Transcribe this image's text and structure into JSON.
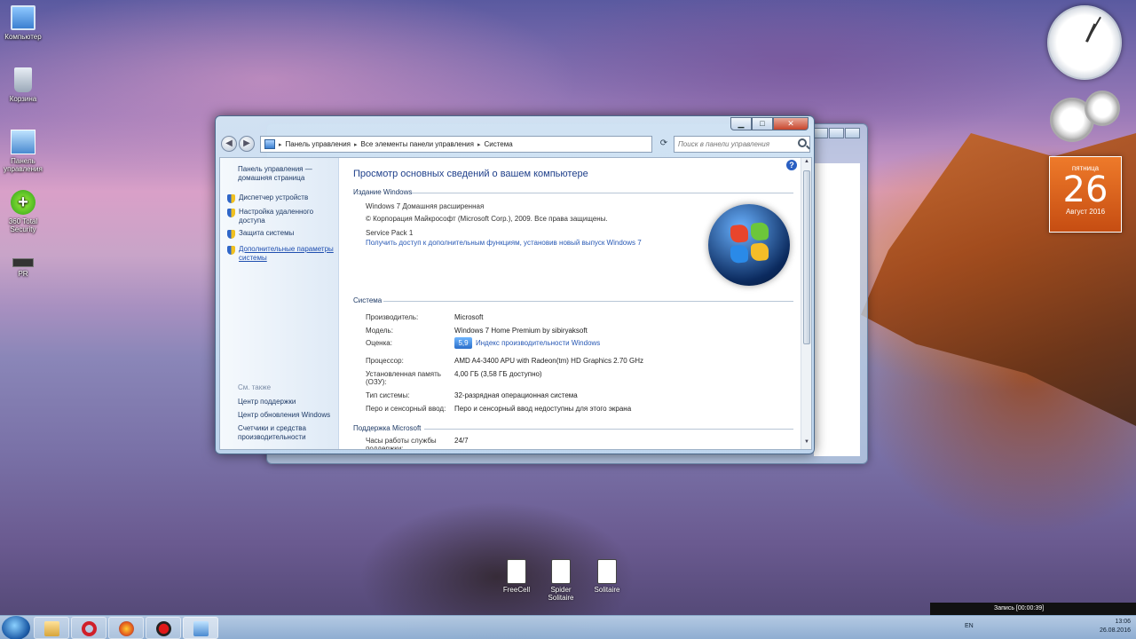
{
  "desktop": {
    "icons": [
      {
        "label": "Компьютер"
      },
      {
        "label": "Корзина"
      },
      {
        "label": "Панель управления"
      },
      {
        "label": "360 Total Security"
      },
      {
        "label": "PR"
      }
    ],
    "games": [
      {
        "label": "FreeCell"
      },
      {
        "label": "Spider Solitaire"
      },
      {
        "label": "Solitaire"
      }
    ]
  },
  "window": {
    "controls": {
      "minimize": "▁",
      "maximize": "□",
      "close": "✕"
    },
    "nav": {
      "back": "◀",
      "forward": "▶"
    },
    "breadcrumb": [
      "Панель управления",
      "Все элементы панели управления",
      "Система"
    ],
    "search_placeholder": "Поиск в панели управления",
    "sidebar": {
      "home": "Панель управления — домашняя страница",
      "items": [
        "Диспетчер устройств",
        "Настройка удаленного доступа",
        "Защита системы",
        "Дополнительные параметры системы"
      ],
      "see_also_label": "См. также",
      "see_also": [
        "Центр поддержки",
        "Центр обновления Windows",
        "Счетчики и средства производительности"
      ]
    },
    "main": {
      "title": "Просмотр основных сведений о вашем компьютере",
      "edition_header": "Издание Windows",
      "edition": "Windows 7 Домашняя расширенная",
      "copyright": "© Корпорация Майкрософт (Microsoft Corp.), 2009. Все права защищены.",
      "service_pack": "Service Pack 1",
      "upgrade_link": "Получить доступ к дополнительным функциям, установив новый выпуск Windows 7",
      "system_header": "Система",
      "rows": [
        {
          "label": "Производитель:",
          "value": "Microsoft"
        },
        {
          "label": "Модель:",
          "value": "Windows 7 Home Premium by sibiryaksoft"
        },
        {
          "label": "Оценка:",
          "value": "Индекс производительности Windows"
        },
        {
          "label": "Процессор:",
          "value": "AMD A4-3400 APU with Radeon(tm) HD Graphics   2.70 GHz"
        },
        {
          "label": "Установленная память (ОЗУ):",
          "value": "4,00 ГБ (3,58 ГБ доступно)"
        },
        {
          "label": "Тип системы:",
          "value": "32-разрядная операционная система"
        },
        {
          "label": "Перо и сенсорный ввод:",
          "value": "Перо и сенсорный ввод недоступны для этого экрана"
        }
      ],
      "rating_badge": "5,9",
      "support_header": "Поддержка Microsoft",
      "support_label": "Часы работы службы поддержки:",
      "support_value": "24/7"
    }
  },
  "gadgets": {
    "calendar": {
      "weekday": "пятница",
      "day": "26",
      "month": "Август 2016"
    }
  },
  "recording": {
    "text": "Запись [00:00:39]"
  },
  "taskbar": {
    "lang": "EN",
    "time": "13:06",
    "date": "26.08.2016"
  },
  "colors": {
    "link": "#2859b5",
    "title": "#1e3f8a",
    "calendar": "#e06a20"
  }
}
